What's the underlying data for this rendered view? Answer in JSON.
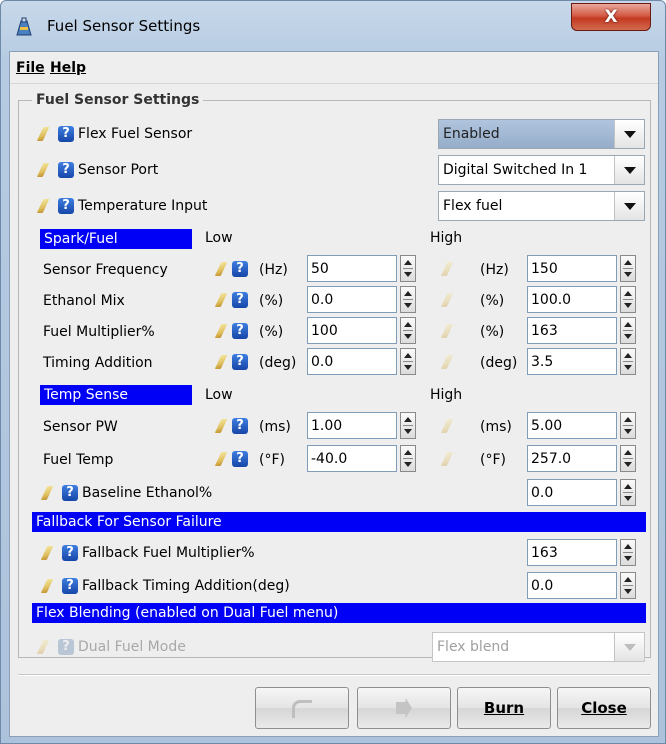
{
  "window": {
    "title": "Fuel Sensor Settings",
    "close_glyph": "X"
  },
  "menu": {
    "file": "File",
    "help": "Help"
  },
  "group_title": "Fuel Sensor Settings",
  "flex_fuel_sensor": {
    "label": "Flex Fuel Sensor",
    "value": "Enabled"
  },
  "sensor_port": {
    "label": "Sensor Port",
    "value": "Digital Switched In 1"
  },
  "temperature_input": {
    "label": "Temperature Input",
    "value": "Flex fuel"
  },
  "spark_fuel": {
    "header": "Spark/Fuel",
    "low": "Low",
    "high": "High",
    "rows": [
      {
        "label": "Sensor Frequency",
        "unit": "(Hz)",
        "low": "50",
        "high": "150"
      },
      {
        "label": "Ethanol Mix",
        "unit": "(%)",
        "low": "0.0",
        "high": "100.0"
      },
      {
        "label": "Fuel Multiplier%",
        "unit": "(%)",
        "low": "100",
        "high": "163"
      },
      {
        "label": "Timing Addition",
        "unit": "(deg)",
        "low": "0.0",
        "high": "3.5"
      }
    ]
  },
  "temp_sense": {
    "header": "Temp Sense",
    "low": "Low",
    "high": "High",
    "rows": [
      {
        "label": "Sensor PW",
        "unit": "(ms)",
        "low": "1.00",
        "high": "5.00"
      },
      {
        "label": "Fuel Temp",
        "unit": "(°F)",
        "low": "-40.0",
        "high": "257.0"
      }
    ]
  },
  "baseline_ethanol": {
    "label": "Baseline Ethanol%",
    "value": "0.0"
  },
  "fallback": {
    "header": "Fallback For Sensor Failure",
    "fuel_multiplier": {
      "label": "Fallback Fuel Multiplier%",
      "value": "163"
    },
    "timing_addition": {
      "label": "Fallback Timing Addition(deg)",
      "value": "0.0"
    }
  },
  "flex_blending": {
    "header": "Flex Blending (enabled on Dual Fuel menu)",
    "dual_fuel_mode": {
      "label": "Dual Fuel Mode",
      "value": "Flex blend"
    }
  },
  "buttons": {
    "burn": "Burn",
    "close": "Close"
  },
  "colors": {
    "section_header": "#0000f6",
    "title_bar": "#b6cbe2",
    "close_button": "#c23a22"
  },
  "icons": [
    "app-icon",
    "pencil-icon",
    "help-icon",
    "dropdown-arrow-icon",
    "spinner-icon",
    "undo-icon",
    "redo-icon",
    "close-x-icon"
  ]
}
